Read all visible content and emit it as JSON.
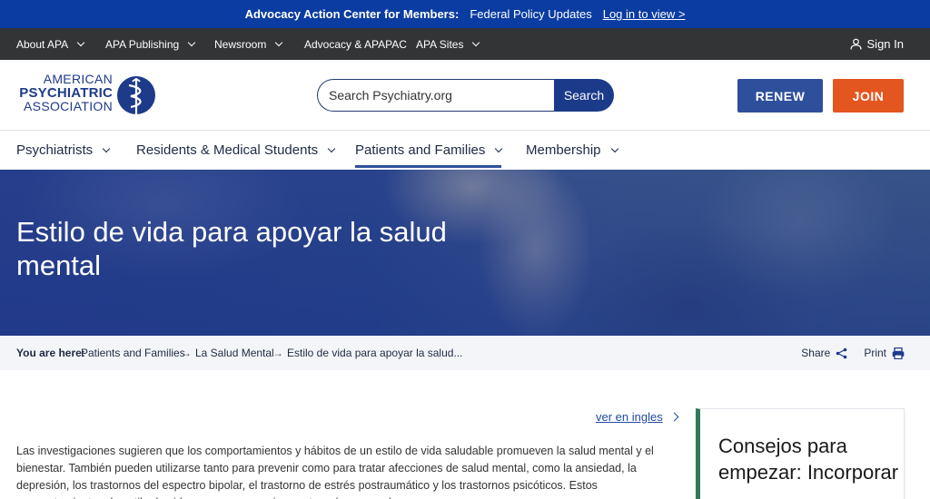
{
  "banner": {
    "title": "Advocacy Action Center for Members:",
    "text": "Federal Policy Updates",
    "link": "Log in to view >"
  },
  "utility_nav": {
    "items": [
      "About APA",
      "APA Publishing",
      "Newsroom",
      "Advocacy & APAPAC",
      "APA Sites"
    ],
    "signin": "Sign In"
  },
  "logo": {
    "line1": "AMERICAN",
    "line2": "PSYCHIATRIC",
    "line3": "ASSOCIATION"
  },
  "search": {
    "placeholder": "Search Psychiatry.org",
    "button": "Search"
  },
  "header_buttons": {
    "renew": "RENEW",
    "join": "JOIN"
  },
  "main_nav": {
    "items": [
      "Psychiatrists",
      "Residents & Medical Students",
      "Patients and Families",
      "Membership"
    ],
    "active": "Patients and Families"
  },
  "hero": {
    "title": "Estilo de vida para apoyar la salud mental"
  },
  "breadcrumb": {
    "label": "You are here:",
    "items": [
      "Patients and Families",
      "La Salud Mental",
      "Estilo de vida para apoyar la salud..."
    ],
    "share": "Share",
    "print": "Print"
  },
  "content": {
    "lang_link": "ver en ingles",
    "paragraph": "Las investigaciones sugieren que los comportamientos y hábitos de un estilo de vida saludable promueven la salud mental y el bienestar. También pueden utilizarse tanto para prevenir como para tratar afecciones de salud mental, como la ansiedad, la depresión, los trastornos del espectro bipolar, el trastorno de estrés postraumático y los trastornos psicóticos. Estos comportamientos de estilo de vida se agrupan en cinco categorías generales:"
  },
  "side_card": {
    "title": "Consejos para empezar: Incorporar"
  },
  "colors": {
    "banner_bg": "#0a3ca2",
    "utility_bg": "#333436",
    "renew": "#2d4f9c",
    "join": "#e4561f",
    "accent_green": "#2f7a5b"
  }
}
